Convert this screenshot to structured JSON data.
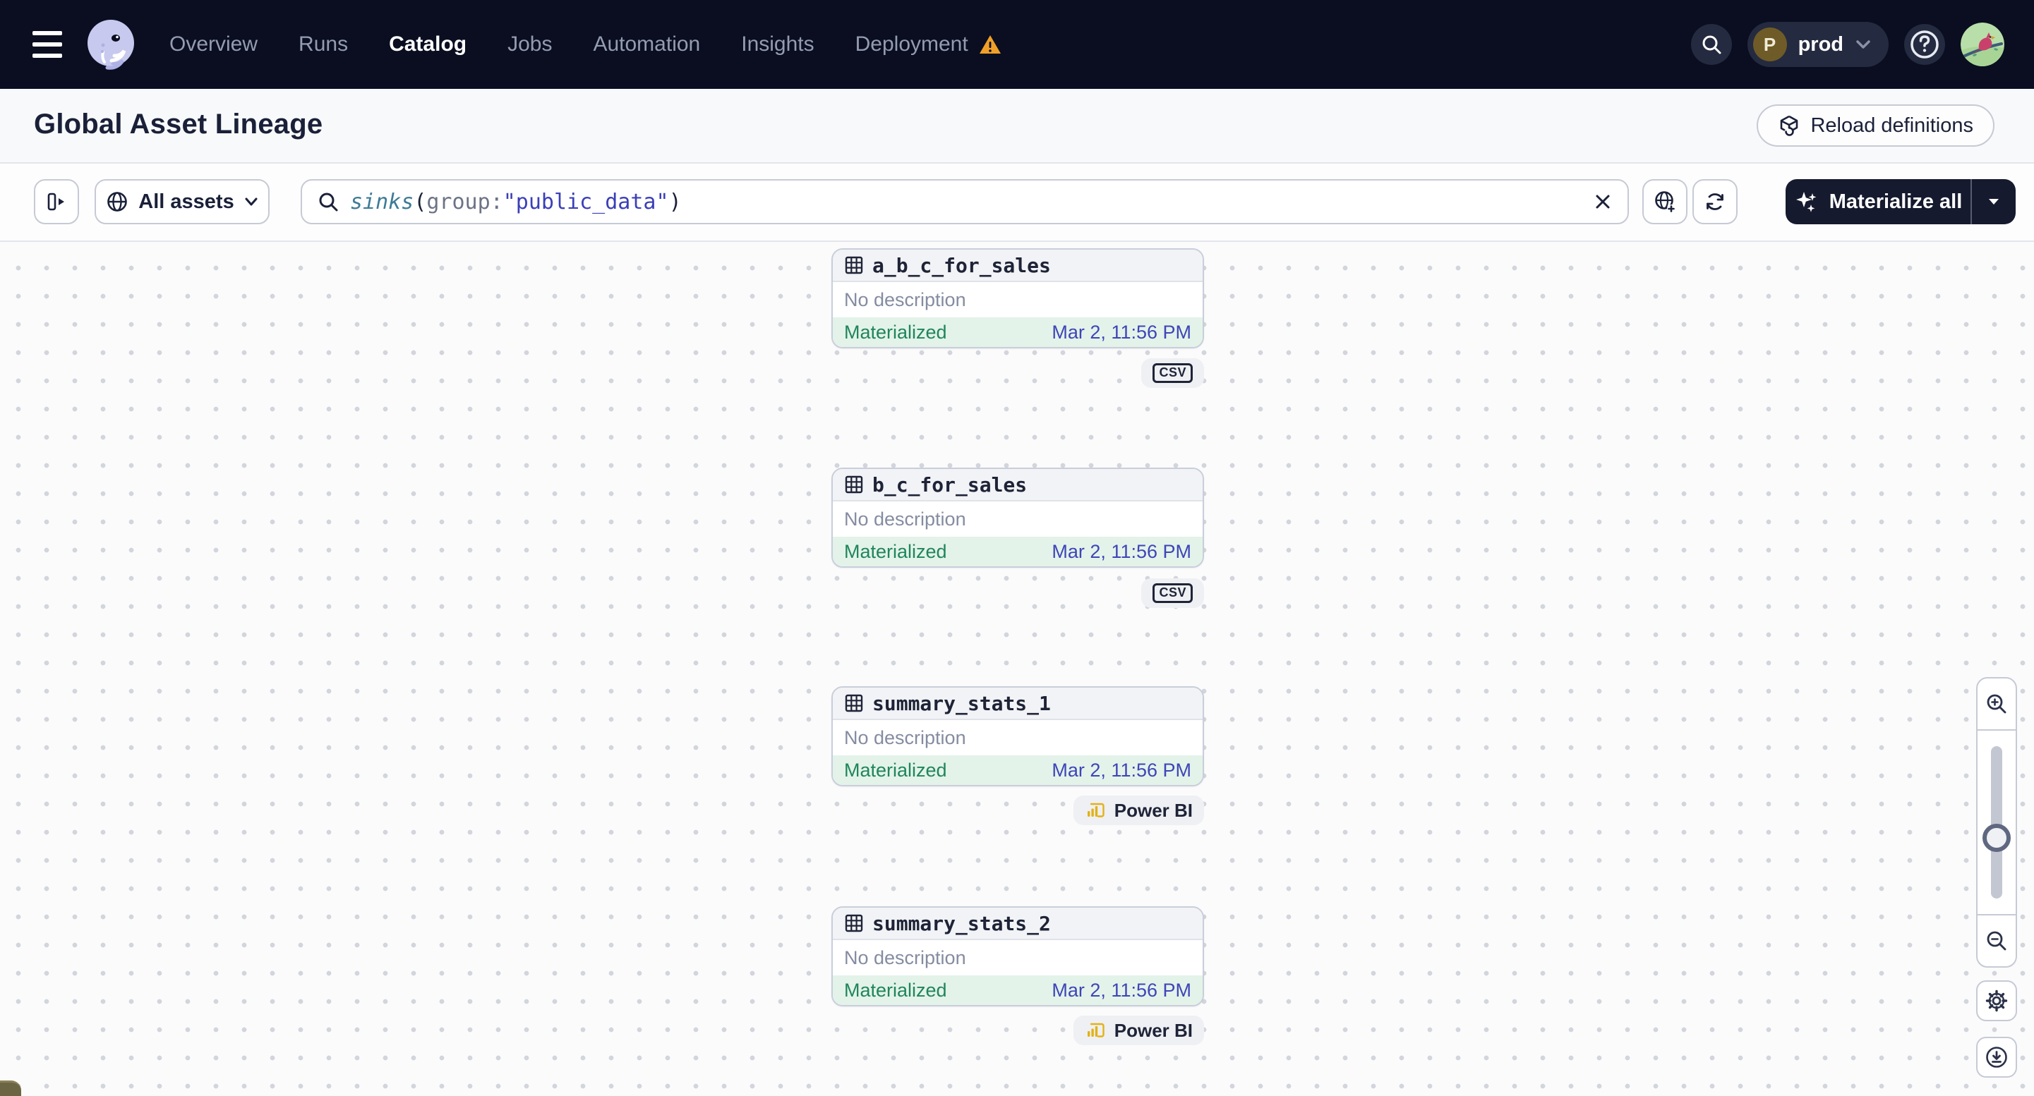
{
  "nav": {
    "items": [
      {
        "label": "Overview"
      },
      {
        "label": "Runs"
      },
      {
        "label": "Catalog"
      },
      {
        "label": "Jobs"
      },
      {
        "label": "Automation"
      },
      {
        "label": "Insights"
      },
      {
        "label": "Deployment"
      }
    ],
    "active_item": "Catalog",
    "environment": {
      "initial": "P",
      "name": "prod"
    }
  },
  "header": {
    "title": "Global Asset Lineage",
    "reload_button": "Reload definitions"
  },
  "toolbar": {
    "scope_label": "All assets",
    "search": {
      "fn": "sinks",
      "open_paren": "(",
      "key": "group",
      "colon": ":",
      "value": "\"public_data\"",
      "close_paren": ")"
    },
    "materialize_label": "Materialize all"
  },
  "graph": {
    "nodes": [
      {
        "name": "a_b_c_for_sales",
        "description": "No description",
        "status": "Materialized",
        "timestamp": "Mar 2, 11:56 PM",
        "badge": "CSV"
      },
      {
        "name": "b_c_for_sales",
        "description": "No description",
        "status": "Materialized",
        "timestamp": "Mar 2, 11:56 PM",
        "badge": "CSV"
      },
      {
        "name": "summary_stats_1",
        "description": "No description",
        "status": "Materialized",
        "timestamp": "Mar 2, 11:56 PM",
        "badge": "Power BI"
      },
      {
        "name": "summary_stats_2",
        "description": "No description",
        "status": "Materialized",
        "timestamp": "Mar 2, 11:56 PM",
        "badge": "Power BI"
      }
    ]
  },
  "colors": {
    "status_green": "#20855A",
    "timestamp_blue": "#3F45B8",
    "warning_orange": "#F0A028",
    "powerbi_yellow": "#E3B118"
  }
}
